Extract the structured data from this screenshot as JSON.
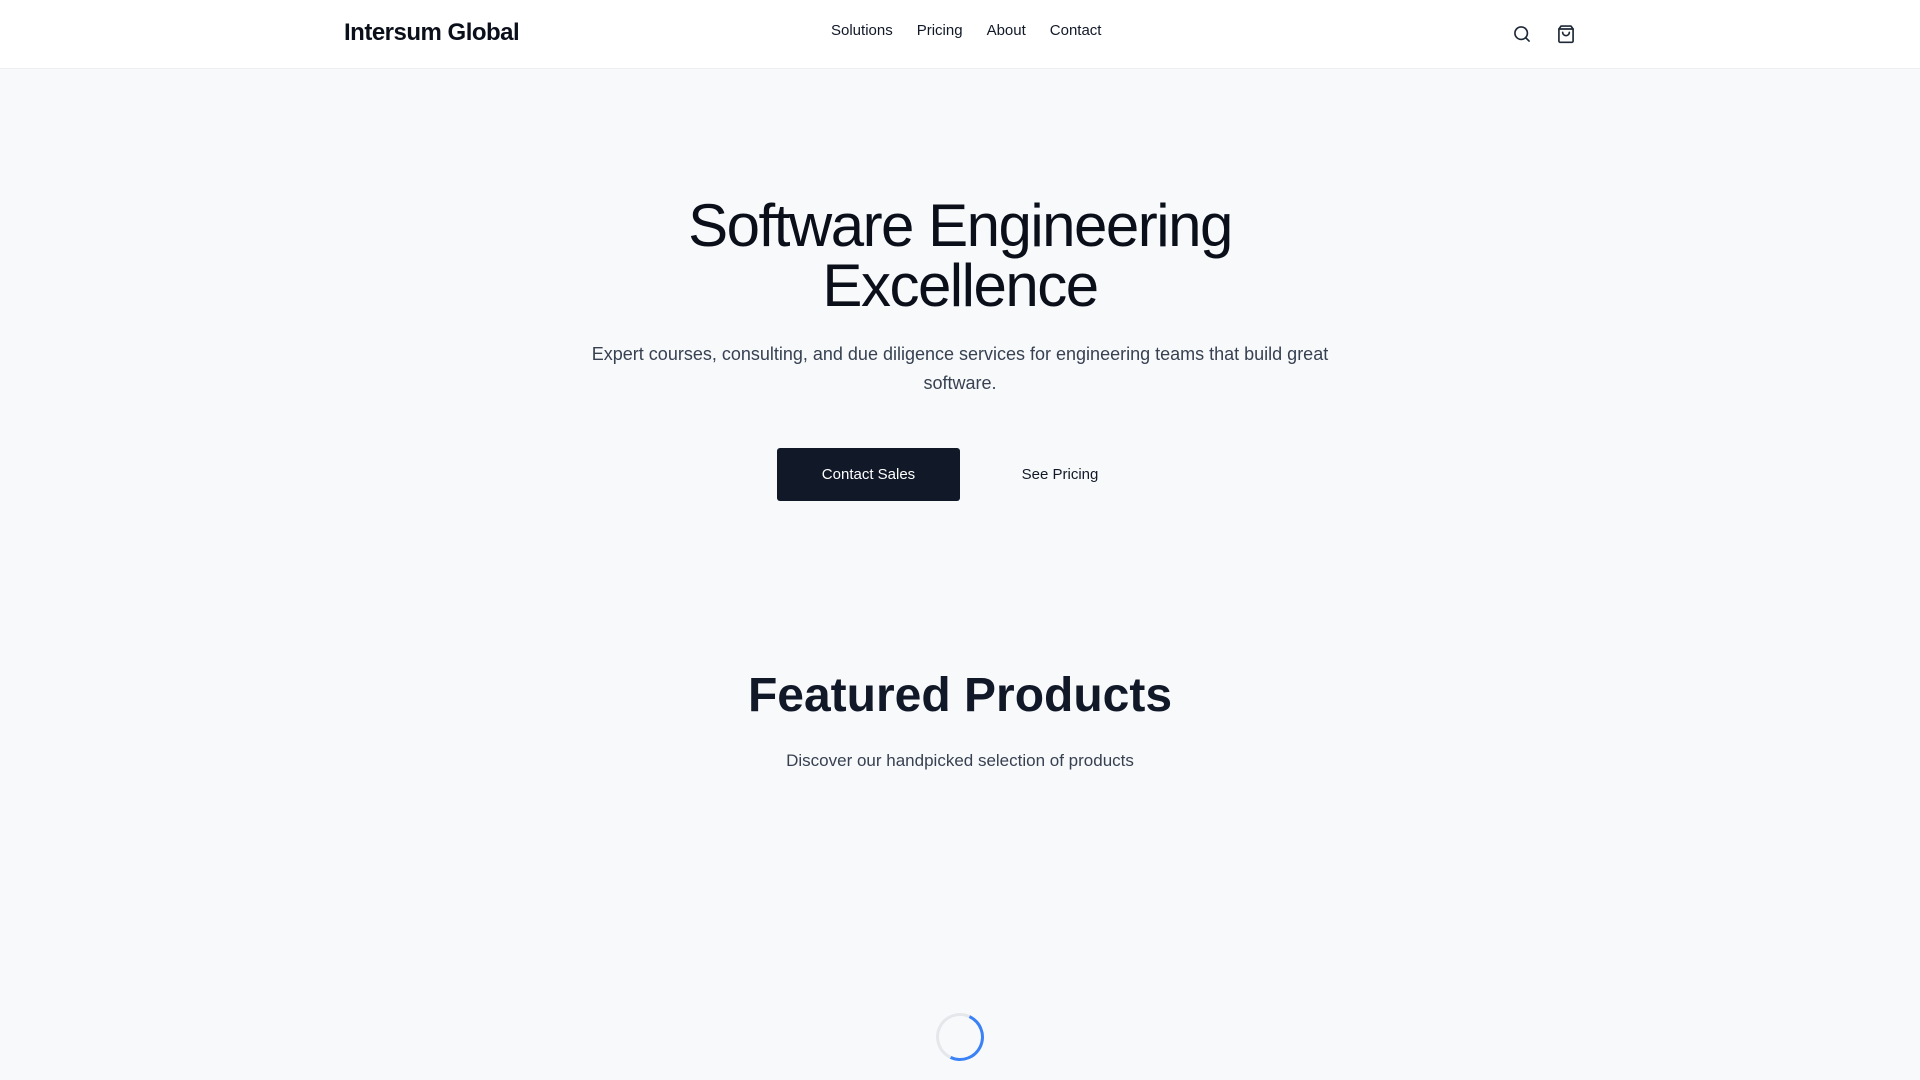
{
  "header": {
    "logo": "Intersum Global",
    "nav": [
      {
        "label": "Solutions"
      },
      {
        "label": "Pricing"
      },
      {
        "label": "About"
      },
      {
        "label": "Contact"
      }
    ],
    "icons": [
      "search-icon",
      "shopping-bag-icon"
    ]
  },
  "hero": {
    "title_line1": "Software Engineering",
    "title_line2": "Excellence",
    "subtitle": "Expert courses, consulting, and due diligence services for engineering teams that build great software.",
    "primary_button": "Contact Sales",
    "secondary_button": "See Pricing"
  },
  "featured": {
    "title": "Featured Products",
    "subtitle": "Discover our handpicked selection of products"
  },
  "colors": {
    "background": "#f8f9fb",
    "primary": "#111827",
    "spinner_accent": "#3b82f6"
  }
}
